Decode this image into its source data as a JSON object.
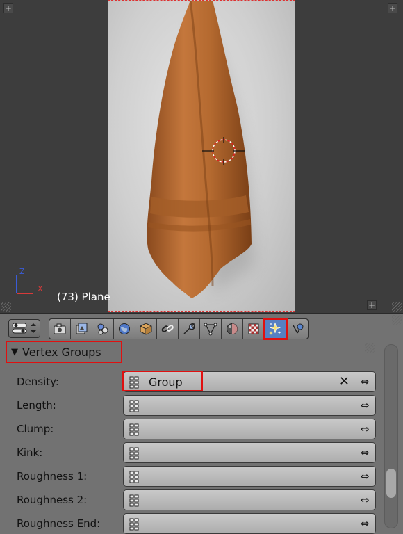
{
  "viewport": {
    "object_label": "(73) Plane",
    "axis_z": "Z",
    "axis_x": "X",
    "corner_plus": "+"
  },
  "toolbar": {
    "tabs": [
      {
        "icon": "render-camera-icon"
      },
      {
        "icon": "render-layers-icon"
      },
      {
        "icon": "scene-icon"
      },
      {
        "icon": "world-icon"
      },
      {
        "icon": "object-icon"
      },
      {
        "icon": "constraints-icon"
      },
      {
        "icon": "modifiers-wrench-icon"
      },
      {
        "icon": "object-data-mesh-icon"
      },
      {
        "icon": "material-icon"
      },
      {
        "icon": "texture-icon"
      },
      {
        "icon": "particles-icon",
        "active": true
      },
      {
        "icon": "physics-icon"
      }
    ],
    "active_color": "#5680c2",
    "highlight_color": "#e01010"
  },
  "panel": {
    "title": "Vertex Groups",
    "collapse_glyph": "▼",
    "rows": [
      {
        "label": "Density:",
        "value": "Group",
        "clear": "✕",
        "swap": "⇔"
      },
      {
        "label": "Length:",
        "value": "",
        "swap": "⇔"
      },
      {
        "label": "Clump:",
        "value": "",
        "swap": "⇔"
      },
      {
        "label": "Kink:",
        "value": "",
        "swap": "⇔"
      },
      {
        "label": "Roughness 1:",
        "value": "",
        "swap": "⇔"
      },
      {
        "label": "Roughness 2:",
        "value": "",
        "swap": "⇔"
      },
      {
        "label": "Roughness End:",
        "value": "",
        "swap": "⇔"
      }
    ]
  }
}
